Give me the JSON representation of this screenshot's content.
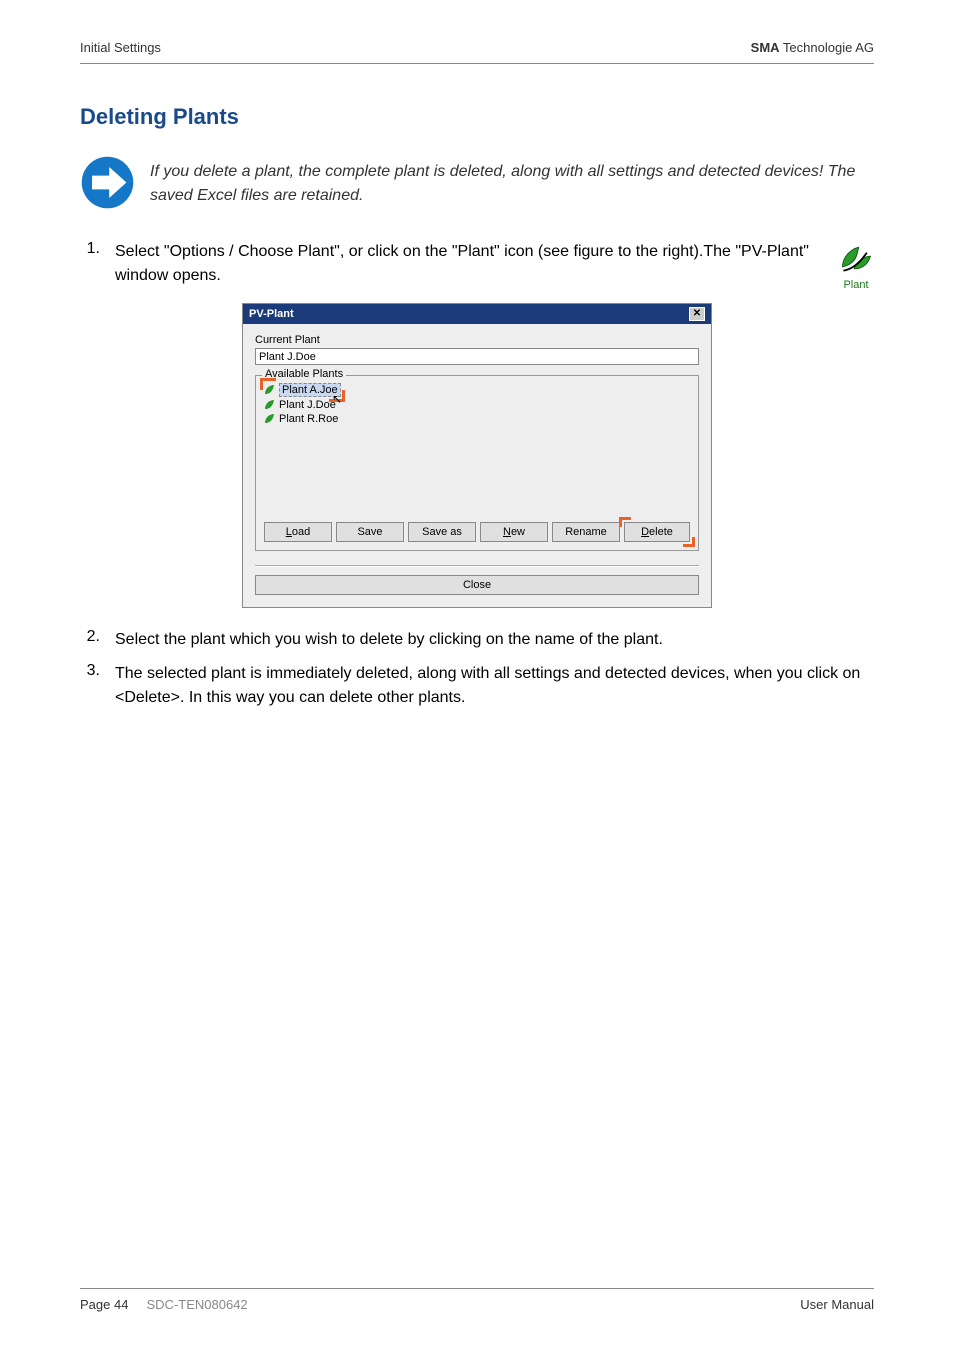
{
  "header": {
    "left": "Initial Settings",
    "right_bold": "SMA",
    "right_rest": " Technologie AG"
  },
  "section_title": "Deleting Plants",
  "note": "If you delete a plant, the complete plant is deleted, along with all settings and detected devices! The saved Excel files are retained.",
  "steps": {
    "s1": "Select \"Options / Choose Plant\", or click on the \"Plant\" icon (see figure to the right).The \"PV-Plant\" window opens.",
    "s2": "Select the plant which you wish to delete by clicking on the name of the plant.",
    "s3": "The selected plant is immediately deleted, along with all settings and detected devices, when you click on <Delete>. In this way you can delete other plants."
  },
  "plant_icon_label": "Plant",
  "dialog": {
    "title": "PV-Plant",
    "current_label": "Current Plant",
    "current_value": "Plant J.Doe",
    "available_label": "Available Plants",
    "plants": {
      "p0": "Plant A.Joe",
      "p1": "Plant J.Doe",
      "p2": "Plant R.Roe"
    },
    "buttons": {
      "load": "Load",
      "save": "Save",
      "saveas": "Save as",
      "new_prefix": "N",
      "new_rest": "ew",
      "rename": "Rename",
      "delete_prefix": "D",
      "delete_rest": "elete",
      "close": "Close"
    }
  },
  "footer": {
    "page": "Page 44",
    "doc": "SDC-TEN080642",
    "right": "User Manual"
  }
}
